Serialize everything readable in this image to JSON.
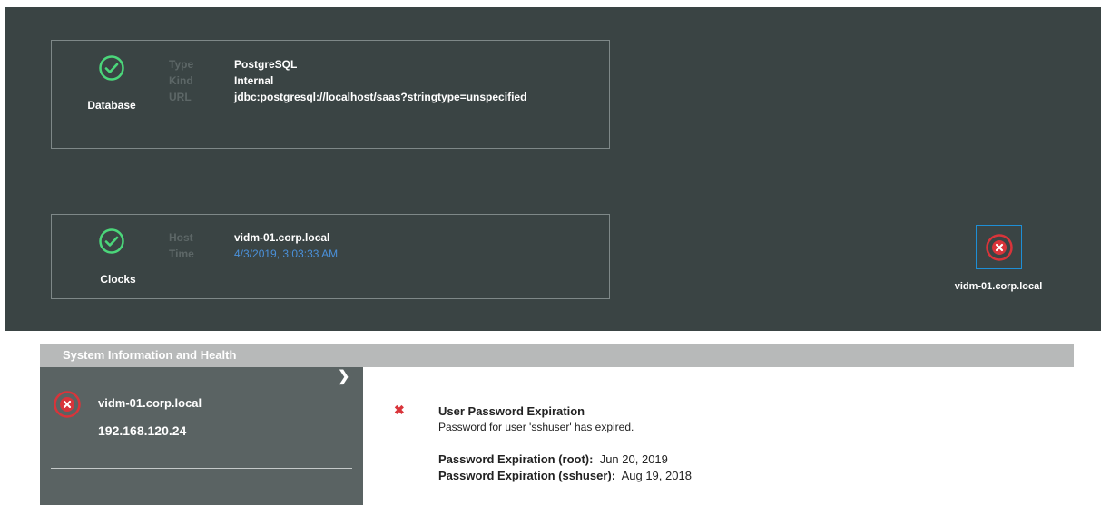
{
  "database": {
    "label": "Database",
    "keys": [
      "Type",
      "Kind",
      "URL"
    ],
    "type": "PostgreSQL",
    "kind": "Internal",
    "url": "jdbc:postgresql://localhost/saas?stringtype=unspecified"
  },
  "clocks": {
    "label": "Clocks",
    "keys": [
      "Host",
      "Time"
    ],
    "host": "vidm-01.corp.local",
    "time": "4/3/2019, 3:03:33 AM"
  },
  "node": {
    "label": "vidm-01.corp.local",
    "status": "error"
  },
  "panel": {
    "title": "System Information and Health",
    "host": {
      "name": "vidm-01.corp.local",
      "ip": "192.168.120.24",
      "status": "error"
    },
    "alert": {
      "title": "User Password Expiration",
      "description": "Password for user 'sshuser' has expired.",
      "root_label": "Password Expiration (root):",
      "root_value": "Jun 20, 2019",
      "sshuser_label": "Password Expiration (sshuser):",
      "sshuser_value": "Aug 19, 2018"
    }
  },
  "icons": {
    "ok": "check-circle-icon",
    "error": "x-circle-icon",
    "expand": "chevron-right-icon"
  },
  "colors": {
    "ok": "#4bd67a",
    "error": "#d9343a",
    "accent": "#1e8fd6",
    "time": "#4a90d9"
  }
}
